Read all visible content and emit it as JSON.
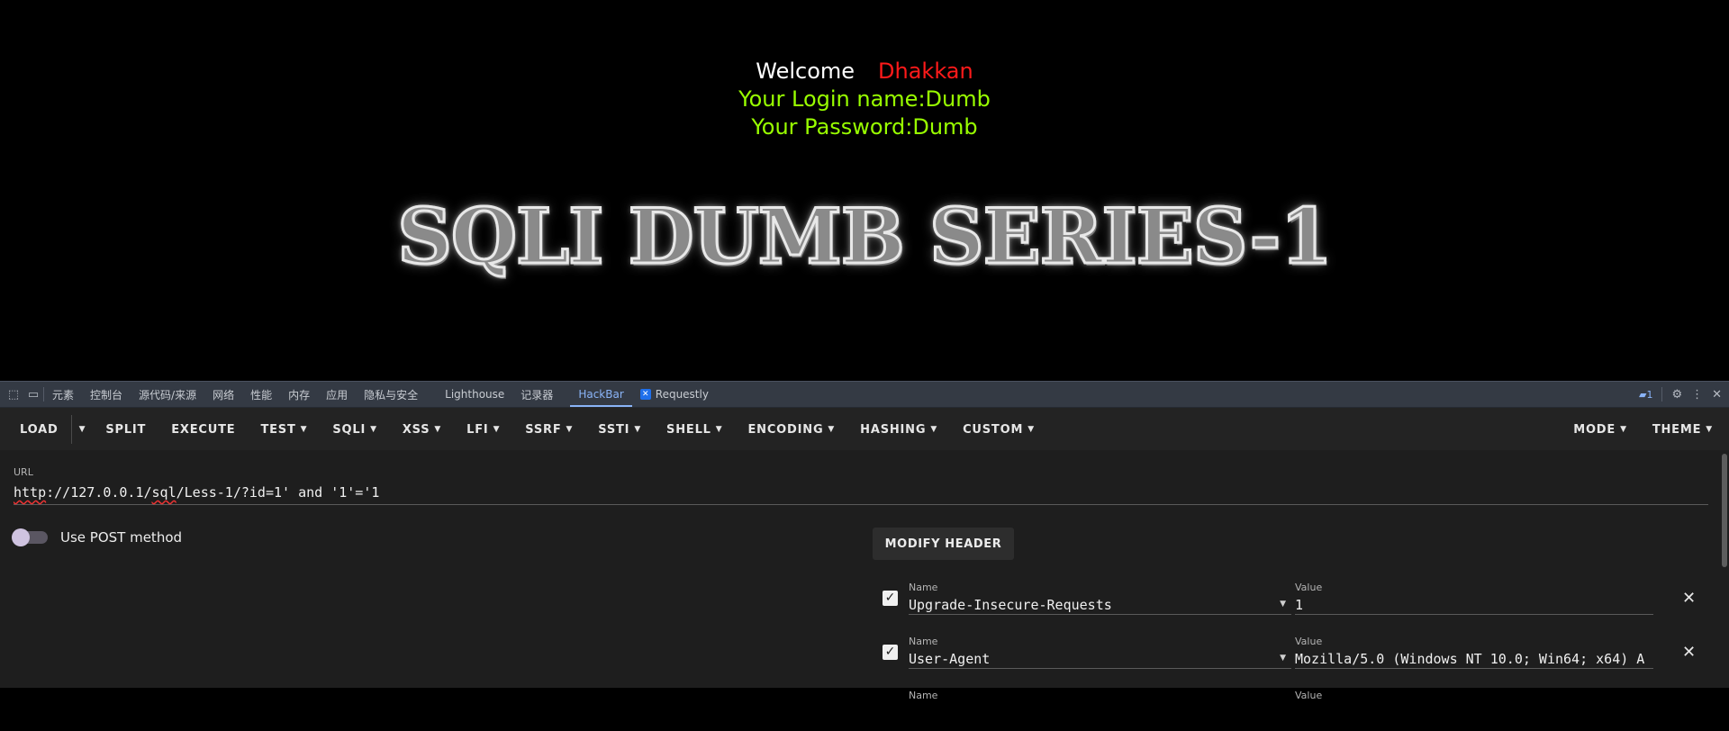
{
  "page": {
    "welcome_label": "Welcome",
    "welcome_name": "Dhakkan",
    "login_line": "Your Login name:Dumb",
    "password_line": "Your Password:Dumb",
    "banner": "SQLI DUMB SERIES-1",
    "colors": {
      "welcome": "#ffffff",
      "name": "#ff1a1a",
      "info": "#99ff00",
      "background": "#000000"
    }
  },
  "devtools": {
    "tabs": [
      "元素",
      "控制台",
      "源代码/来源",
      "网络",
      "性能",
      "内存",
      "应用",
      "隐私与安全",
      "Lighthouse",
      "记录器",
      "HackBar",
      "Requestly"
    ],
    "active_tab": "HackBar",
    "issues_count": "1"
  },
  "hackbar": {
    "toolbar_left": [
      "LOAD",
      "SPLIT",
      "EXECUTE",
      "TEST",
      "SQLI",
      "XSS",
      "LFI",
      "SSRF",
      "SSTI",
      "SHELL",
      "ENCODING",
      "HASHING",
      "CUSTOM"
    ],
    "toolbar_right": [
      "MODE",
      "THEME"
    ],
    "url_label": "URL",
    "url_prefix": "http",
    "url_p": "://127.0.0.1/",
    "url_sql": "sql",
    "url_rest": "/Less-1/?id=1' and '1'='1",
    "post_label": "Use POST method",
    "modify_header": "MODIFY HEADER",
    "headers": [
      {
        "name_label": "Name",
        "name": "Upgrade-Insecure-Requests",
        "value_label": "Value",
        "value": "1"
      },
      {
        "name_label": "Name",
        "name": "User-Agent",
        "value_label": "Value",
        "value": "Mozilla/5.0 (Windows NT 10.0; Win64; x64) A"
      },
      {
        "name_label": "Name",
        "name": "",
        "value_label": "Value",
        "value": ""
      }
    ]
  }
}
